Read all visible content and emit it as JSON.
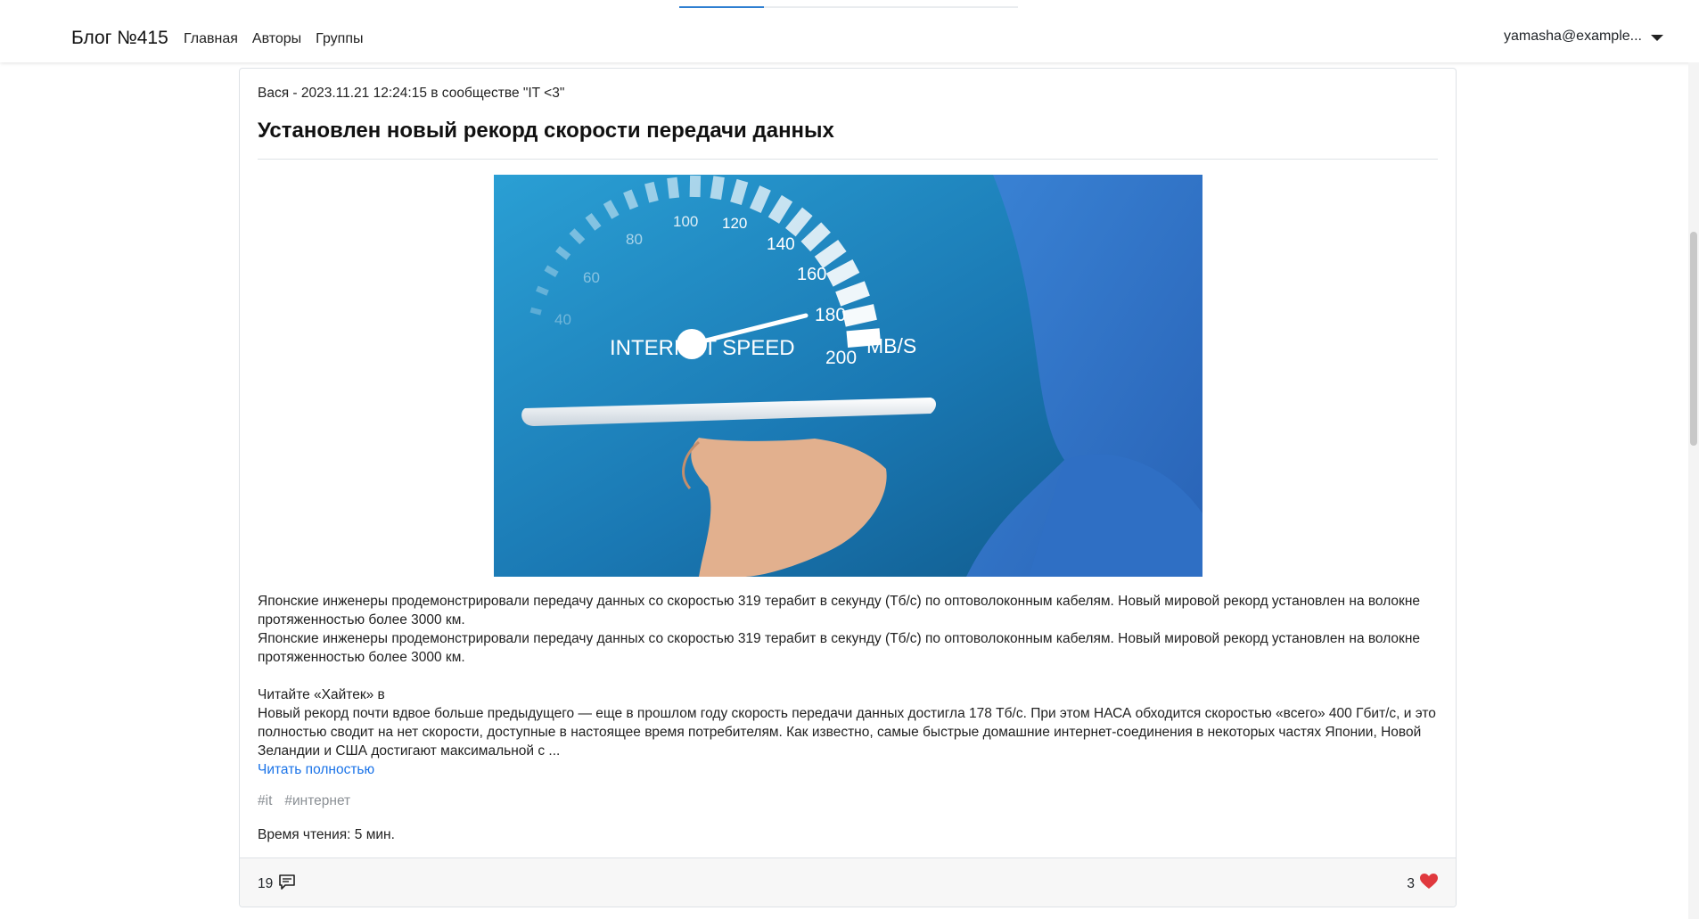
{
  "navbar": {
    "brand": "Блог №415",
    "links": [
      "Главная",
      "Авторы",
      "Группы"
    ],
    "user": "yamasha@example...",
    "progress": 0.25
  },
  "post": {
    "meta": "Вася - 2023.11.21 12:24:15 в сообществе \"IT <3\"",
    "title": "Установлен новый рекорд скорости передачи данных",
    "image": {
      "gauge_numbers": [
        "40",
        "60",
        "80",
        "100",
        "120",
        "140",
        "160",
        "180",
        "200"
      ],
      "caption": "INTERNET SPEED",
      "unit": "MB/S"
    },
    "paragraphs": [
      "Японские инженеры продемонстрировали передачу данных со скоростью 319 терабит в секунду (Тб/с) по оптоволоконным кабелям. Новый мировой рекорд установлен на волокне протяженностью более 3000 км.",
      "Японские инженеры продемонстрировали передачу данных со скоростью 319 терабит в секунду (Тб/с) по оптоволоконным кабелям. Новый мировой рекорд установлен на волокне протяженностью более 3000 км.",
      "Читайте «Хайтек» в",
      "Новый рекорд почти вдвое больше предыдущего — еще в прошлом году скорость передачи данных достигла 178 Тб/с. При этом НАСА обходится скоростью «всего» 400 Гбит/с, и это полностью сводит на нет скорости, доступные в настоящее время потребителям. Как известно, самые быстрые домашние интернет-соединения в некоторых частях Японии, Новой Зеландии и США достигают максимальной с ..."
    ],
    "read_more": "Читать полностью",
    "tags": [
      "#it",
      "#интернет"
    ],
    "reading_time": "Время чтения: 5 мин.",
    "comments_count": "19",
    "likes_count": "3"
  },
  "colors": {
    "link": "#1a73e8",
    "heart": "#e0393e",
    "progress": "#2f7fd1"
  }
}
